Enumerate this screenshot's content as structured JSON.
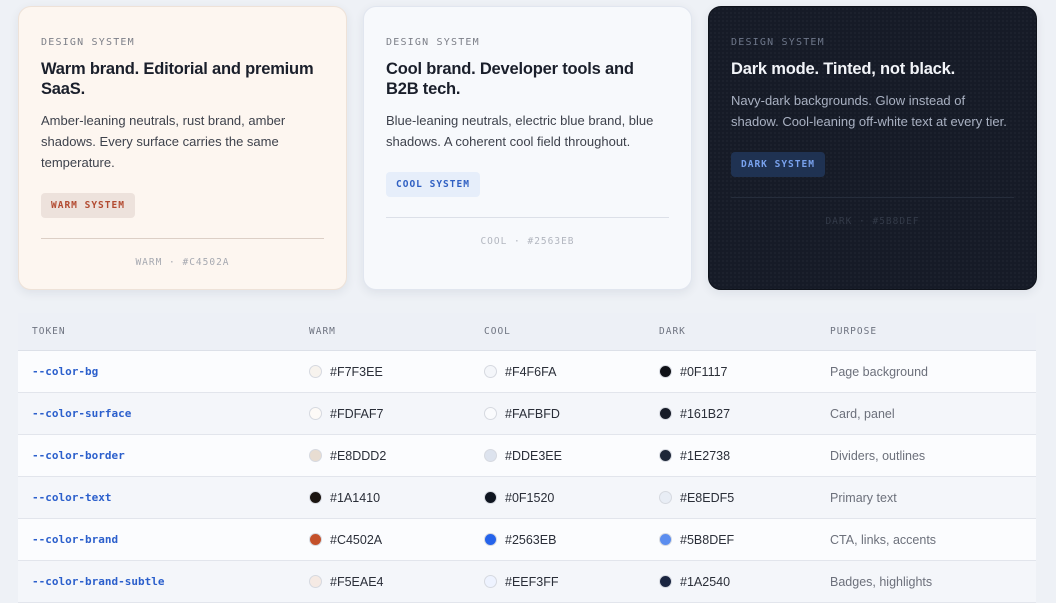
{
  "cards": [
    {
      "id": "warm",
      "eyebrow": "DESIGN SYSTEM",
      "title": "Warm brand. Editorial and premium SaaS.",
      "description": "Amber-leaning neutrals, rust brand, amber shadows. Every surface carries the same temperature.",
      "badge": "WARM SYSTEM",
      "footer": "WARM · #C4502A"
    },
    {
      "id": "cool",
      "eyebrow": "DESIGN SYSTEM",
      "title": "Cool brand. Developer tools and B2B tech.",
      "description": "Blue-leaning neutrals, electric blue brand, blue shadows. A coherent cool field throughout.",
      "badge": "COOL SYSTEM",
      "footer": "COOL · #2563EB"
    },
    {
      "id": "dark",
      "eyebrow": "DESIGN SYSTEM",
      "title": "Dark mode. Tinted, not black.",
      "description": "Navy-dark backgrounds. Glow instead of shadow. Cool-leaning off-white text at every tier.",
      "badge": "DARK SYSTEM",
      "footer": "DARK · #5B8DEF"
    }
  ],
  "table": {
    "headers": [
      "TOKEN",
      "WARM",
      "COOL",
      "DARK",
      "PURPOSE"
    ],
    "rows": [
      {
        "token": "--color-bg",
        "warm": "#F7F3EE",
        "cool": "#F4F6FA",
        "dark": "#0F1117",
        "purpose": "Page background"
      },
      {
        "token": "--color-surface",
        "warm": "#FDFAF7",
        "cool": "#FAFBFD",
        "dark": "#161B27",
        "purpose": "Card, panel"
      },
      {
        "token": "--color-border",
        "warm": "#E8DDD2",
        "cool": "#DDE3EE",
        "dark": "#1E2738",
        "purpose": "Dividers, outlines"
      },
      {
        "token": "--color-text",
        "warm": "#1A1410",
        "cool": "#0F1520",
        "dark": "#E8EDF5",
        "purpose": "Primary text"
      },
      {
        "token": "--color-brand",
        "warm": "#C4502A",
        "cool": "#2563EB",
        "dark": "#5B8DEF",
        "purpose": "CTA, links, accents"
      },
      {
        "token": "--color-brand-subtle",
        "warm": "#F5EAE4",
        "cool": "#EEF3FF",
        "dark": "#1A2540",
        "purpose": "Badges, highlights"
      }
    ]
  }
}
